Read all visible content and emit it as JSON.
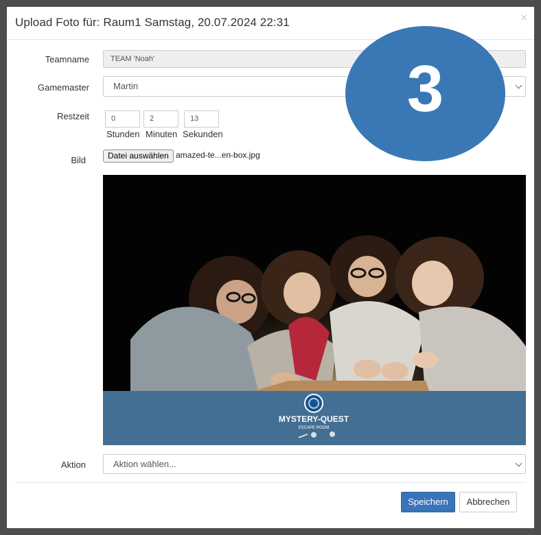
{
  "modal": {
    "title": "Upload Foto für: Raum1 Samstag, 20.07.2024 22:31",
    "close_label": "×"
  },
  "form": {
    "teamname": {
      "label": "Teamname",
      "value": "TEAM 'Noah'"
    },
    "gamemaster": {
      "label": "Gamemaster",
      "selected": "Martin"
    },
    "restzeit": {
      "label": "Restzeit",
      "hours": {
        "value": "0",
        "caption": "Stunden"
      },
      "minutes": {
        "value": "2",
        "caption": "Minuten"
      },
      "seconds": {
        "value": "13",
        "caption": "Sekunden"
      }
    },
    "bild": {
      "label": "Bild",
      "button_label": "Datei auswählen",
      "file_name": "amazed-te...en-box.jpg"
    },
    "aktion": {
      "label": "Aktion",
      "selected": "Aktion wählen..."
    }
  },
  "photo": {
    "logo_line1": "MYSTERY-QUEST",
    "logo_line2": "ESCAPE ROOM"
  },
  "footer": {
    "save_label": "Speichern",
    "cancel_label": "Abbrechen"
  },
  "overlay_badge": {
    "number": "3",
    "color": "#3a78b5"
  },
  "colors": {
    "primary": "#3a73b7",
    "photo_strip": "#426f93",
    "backdrop": "#4d4d4d"
  }
}
